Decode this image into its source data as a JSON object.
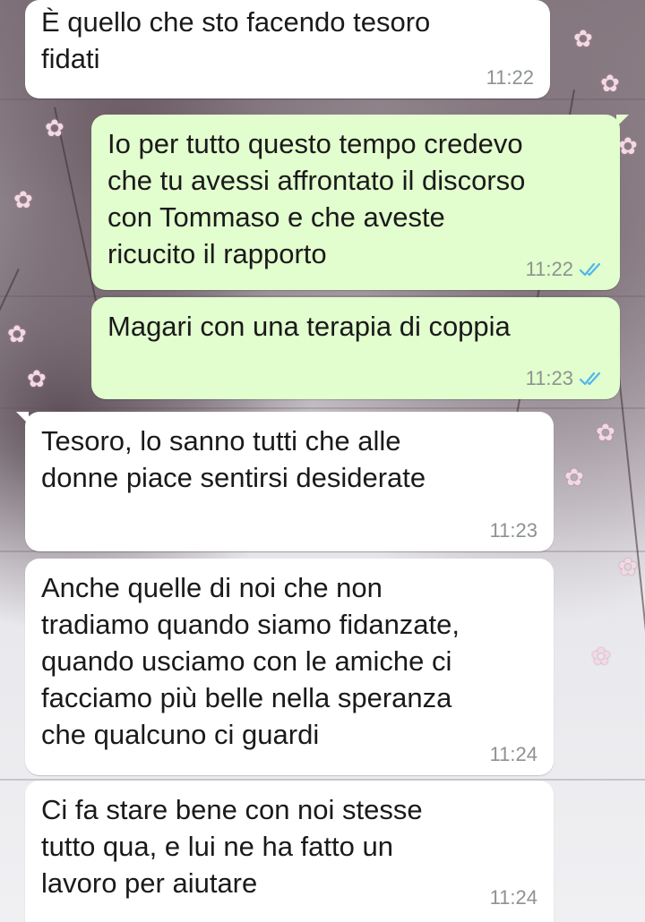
{
  "chat": {
    "messages": [
      {
        "direction": "incoming",
        "text": "È quello che sto facendo tesoro\nfidati",
        "time": "11:22"
      },
      {
        "direction": "outgoing",
        "text": "Io per tutto questo tempo credevo\nche tu avessi affrontato il discorso\ncon Tommaso e che aveste\nricucito il rapporto",
        "time": "11:22",
        "status": "read"
      },
      {
        "direction": "outgoing",
        "text": "Magari con una terapia di coppia",
        "time": "11:23",
        "status": "read"
      },
      {
        "direction": "incoming",
        "text": "Tesoro, lo sanno tutti che alle\ndonne piace sentirsi desiderate",
        "time": "11:23"
      },
      {
        "direction": "incoming",
        "text": "Anche quelle di noi che non\ntradiamo quando siamo fidanzate,\nquando usciamo con le amiche ci\nfacciamo più belle nella speranza\nche qualcuno ci guardi",
        "time": "11:24"
      },
      {
        "direction": "incoming",
        "text": "Ci fa stare bene con noi stesse\ntutto qua, e lui ne ha fatto un\nlavoro per aiutare",
        "time": "11:24"
      }
    ]
  },
  "icons": {
    "read_receipt": "double-check-icon",
    "wallpaper": "blossom-wallpaper"
  },
  "colors": {
    "incoming_bubble": "#ffffff",
    "outgoing_bubble": "#e2fdce",
    "timestamp": "#8c938e",
    "read_ticks": "#4fb6ec"
  }
}
